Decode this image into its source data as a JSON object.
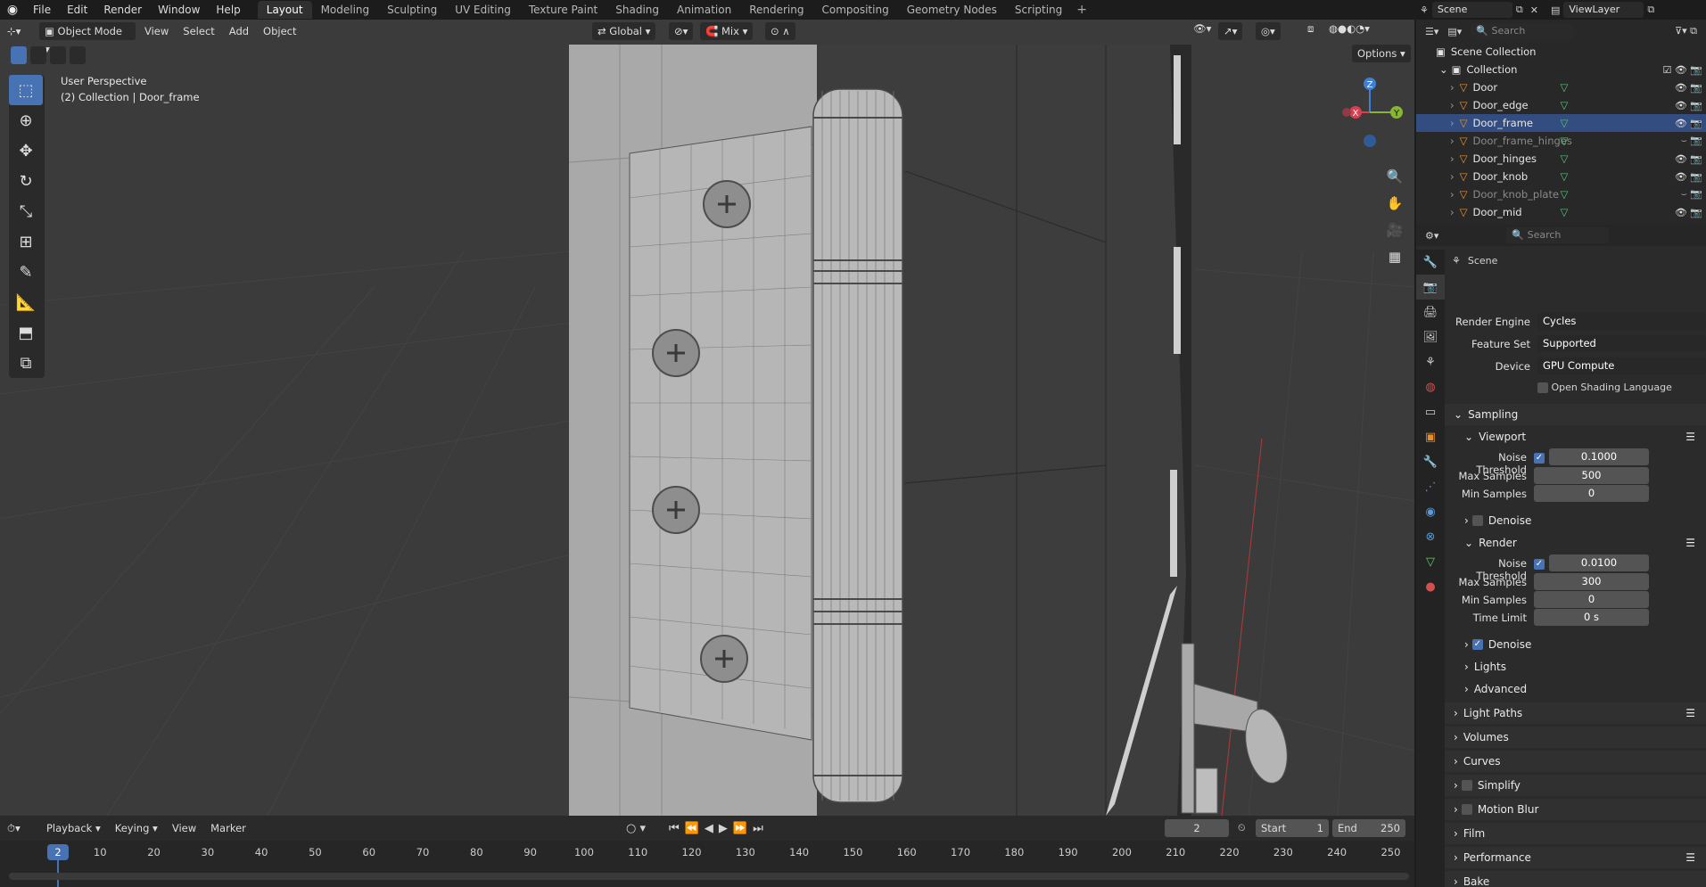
{
  "topbar": {
    "menus": [
      "File",
      "Edit",
      "Render",
      "Window",
      "Help"
    ],
    "workspaces": [
      "Layout",
      "Modeling",
      "Sculpting",
      "UV Editing",
      "Texture Paint",
      "Shading",
      "Animation",
      "Rendering",
      "Compositing",
      "Geometry Nodes",
      "Scripting"
    ],
    "active_workspace": "Layout",
    "scene_name": "Scene",
    "view_layer": "ViewLayer"
  },
  "viewport": {
    "mode": "Object Mode",
    "menus": [
      "View",
      "Select",
      "Add",
      "Object"
    ],
    "transform_orientation": "Global",
    "snap_target": "Mix",
    "options_label": "Options",
    "perspective_label": "User Perspective",
    "object_info": "(2) Collection | Door_frame",
    "gizmo_axes": [
      "X",
      "Y",
      "Z"
    ]
  },
  "toolbar": {
    "tools": [
      "select-box",
      "cursor",
      "move",
      "rotate",
      "scale",
      "transform",
      "annotate",
      "measure",
      "add-cube",
      "extrude-cube"
    ]
  },
  "outliner": {
    "search_placeholder": "Search",
    "root": "Scene Collection",
    "collection": "Collection",
    "items": [
      {
        "name": "Door",
        "selected": false,
        "dim": false
      },
      {
        "name": "Door_edge",
        "selected": false,
        "dim": false
      },
      {
        "name": "Door_frame",
        "selected": true,
        "dim": false
      },
      {
        "name": "Door_frame_hinges",
        "selected": false,
        "dim": true
      },
      {
        "name": "Door_hinges",
        "selected": false,
        "dim": false
      },
      {
        "name": "Door_knob",
        "selected": false,
        "dim": false
      },
      {
        "name": "Door_knob_plate",
        "selected": false,
        "dim": true
      },
      {
        "name": "Door_mid",
        "selected": false,
        "dim": false
      }
    ]
  },
  "properties": {
    "search_placeholder": "Search",
    "context": "Scene",
    "render_engine_label": "Render Engine",
    "render_engine": "Cycles",
    "feature_set_label": "Feature Set",
    "feature_set": "Supported",
    "device_label": "Device",
    "device": "GPU Compute",
    "osl_label": "Open Shading Language",
    "sampling_label": "Sampling",
    "viewport_label": "Viewport",
    "noise_threshold_label": "Noise Threshold",
    "vp_noise_threshold": "0.1000",
    "max_samples_label": "Max Samples",
    "vp_max_samples": "500",
    "min_samples_label": "Min Samples",
    "vp_min_samples": "0",
    "denoise_label": "Denoise",
    "render_label": "Render",
    "r_noise_threshold": "0.0100",
    "r_max_samples": "300",
    "r_min_samples": "0",
    "time_limit_label": "Time Limit",
    "r_time_limit": "0 s",
    "lights_label": "Lights",
    "advanced_label": "Advanced",
    "light_paths_label": "Light Paths",
    "volumes_label": "Volumes",
    "curves_label": "Curves",
    "simplify_label": "Simplify",
    "motion_blur_label": "Motion Blur",
    "film_label": "Film",
    "performance_label": "Performance",
    "bake_label": "Bake"
  },
  "timeline": {
    "menus": [
      "Playback",
      "Keying",
      "View",
      "Marker"
    ],
    "current_frame": "2",
    "start_label": "Start",
    "start": "1",
    "end_label": "End",
    "end": "250",
    "ticks": [
      10,
      20,
      30,
      40,
      50,
      60,
      70,
      80,
      90,
      100,
      110,
      120,
      130,
      140,
      150,
      160,
      170,
      180,
      190,
      200,
      210,
      220,
      230,
      240,
      250
    ],
    "cursor_frame": "2"
  },
  "colors": {
    "accent": "#4772b3",
    "selection": "#334d80",
    "background": "#3a3a3a"
  }
}
